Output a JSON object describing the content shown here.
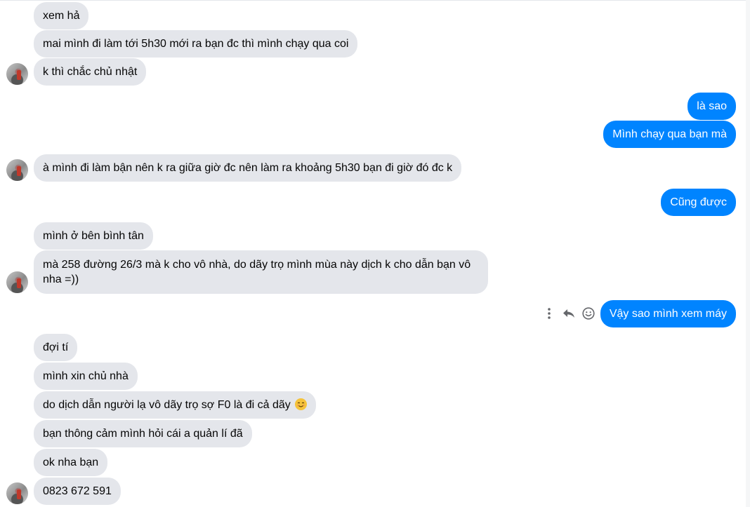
{
  "colors": {
    "incoming_bubble": "#e4e6eb",
    "outgoing_bubble": "#0084ff",
    "incoming_text": "#050505",
    "outgoing_text": "#ffffff"
  },
  "messages": [
    {
      "side": "incoming",
      "text": "xem hả"
    },
    {
      "side": "incoming",
      "text": "mai mình đi làm tới 5h30 mới ra bạn đc thì mình chạy qua coi"
    },
    {
      "side": "incoming",
      "text": "k thì chắc chủ nhật"
    },
    {
      "side": "outgoing",
      "text": "là sao"
    },
    {
      "side": "outgoing",
      "text": "Mình chạy qua bạn mà"
    },
    {
      "side": "incoming",
      "text": "à mình đi làm bận nên k ra giữa giờ đc nên làm ra khoảng 5h30 bạn đi giờ đó đc k"
    },
    {
      "side": "outgoing",
      "text": "Cũng được"
    },
    {
      "side": "incoming",
      "text": "mình ở bên bình tân"
    },
    {
      "side": "incoming",
      "text": "mà 258 đường 26/3 mà k cho vô nhà, do dãy trọ mình mùa này dịch k cho dẫn bạn vô nha =))"
    },
    {
      "side": "outgoing",
      "text": "Vậy sao mình xem máy"
    },
    {
      "side": "incoming",
      "text": "đợi tí"
    },
    {
      "side": "incoming",
      "text": "mình xin chủ nhà"
    },
    {
      "side": "incoming",
      "text": "do dịch dẫn người lạ vô dãy trọ sợ F0 là đi cả dãy",
      "emoji": "smiling-face"
    },
    {
      "side": "incoming",
      "text": "bạn thông cảm mình hỏi cái a quản lí đã"
    },
    {
      "side": "incoming",
      "text": "ok nha bạn"
    },
    {
      "side": "incoming",
      "text": "0823  672 591"
    }
  ],
  "hover_actions": [
    "more-options",
    "reply",
    "react"
  ]
}
